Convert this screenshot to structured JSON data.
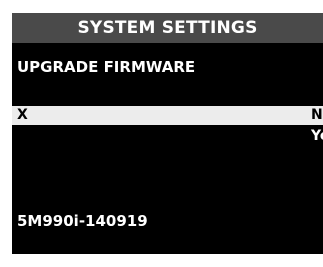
{
  "header": {
    "title": "SYSTEM SETTINGS"
  },
  "screen": {
    "title": "UPGRADE FIRMWARE"
  },
  "menu": {
    "selected_left": "X",
    "selected_right": "N",
    "option_below": "Ye"
  },
  "firmware": {
    "version": "5M990i-140919"
  },
  "colors": {
    "background": "#000000",
    "title_bar": "#4a4a4a",
    "highlight_row": "#ececec",
    "text_light": "#ffffff",
    "text_dark": "#000000"
  }
}
